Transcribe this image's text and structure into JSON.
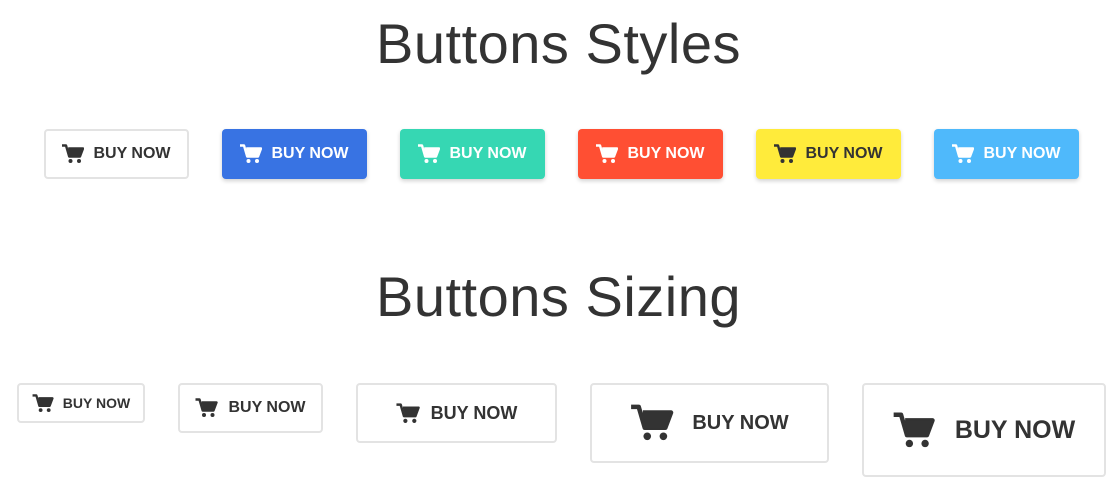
{
  "headings": {
    "styles": "Buttons Styles",
    "sizing": "Buttons Sizing"
  },
  "icon": "shopping-cart-icon",
  "styles_buttons": [
    {
      "label": "BUY NOW",
      "variant": "default",
      "background": "#ffffff",
      "text_color": "#333333"
    },
    {
      "label": "BUY NOW",
      "variant": "blue",
      "background": "#3873e3",
      "text_color": "#ffffff"
    },
    {
      "label": "BUY NOW",
      "variant": "teal",
      "background": "#36d7b3",
      "text_color": "#ffffff"
    },
    {
      "label": "BUY NOW",
      "variant": "red",
      "background": "#ff4f33",
      "text_color": "#ffffff"
    },
    {
      "label": "BUY NOW",
      "variant": "yellow",
      "background": "#ffeb3b",
      "text_color": "#333333"
    },
    {
      "label": "BUY NOW",
      "variant": "light-blue",
      "background": "#4fb9fb",
      "text_color": "#ffffff"
    }
  ],
  "sizing_buttons": [
    {
      "label": "BUY NOW",
      "size": "extra-small"
    },
    {
      "label": "BUY NOW",
      "size": "small"
    },
    {
      "label": "BUY NOW",
      "size": "default"
    },
    {
      "label": "BUY NOW",
      "size": "large"
    },
    {
      "label": "BUY NOW",
      "size": "extra-large"
    }
  ],
  "colors": {
    "heading": "#333333",
    "border": "#e3e3e3"
  }
}
